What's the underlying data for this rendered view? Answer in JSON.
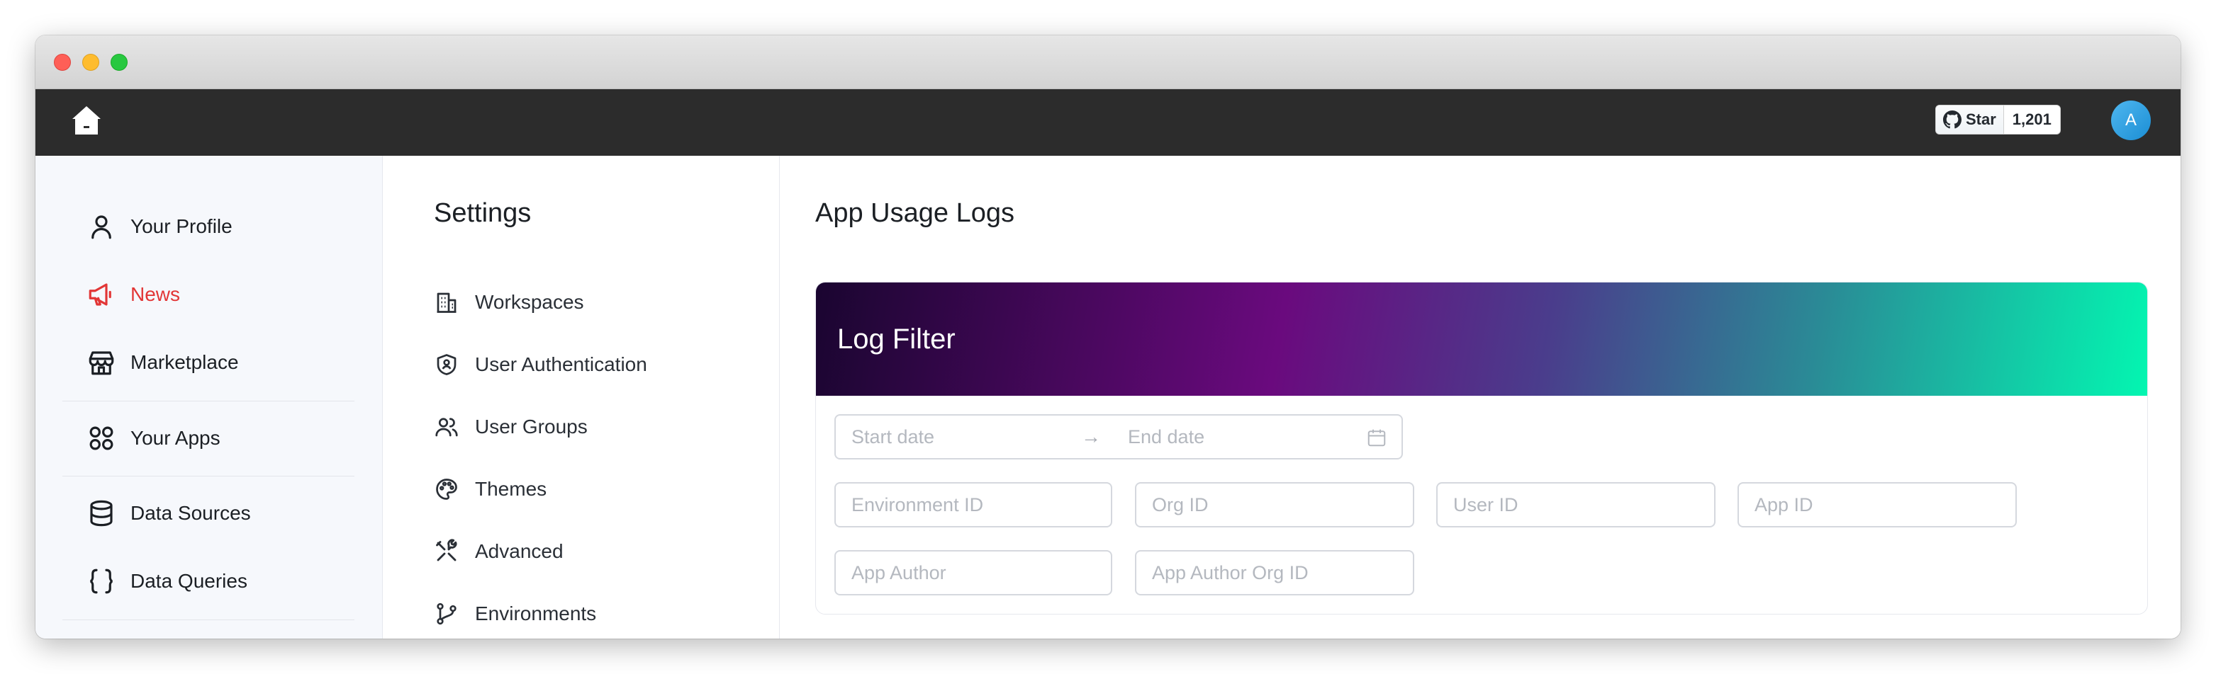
{
  "topbar": {
    "github": {
      "star_label": "Star",
      "count": "1,201"
    },
    "avatar_initial": "A"
  },
  "sidebar": {
    "items": [
      {
        "label": "Your Profile",
        "icon": "user-icon"
      },
      {
        "label": "News",
        "icon": "megaphone-icon",
        "active": true,
        "color": "#e23636"
      },
      {
        "label": "Marketplace",
        "icon": "store-icon"
      },
      {
        "label": "Your Apps",
        "icon": "apps-grid-icon"
      },
      {
        "label": "Data Sources",
        "icon": "database-icon"
      },
      {
        "label": "Data Queries",
        "icon": "braces-icon"
      }
    ]
  },
  "settings": {
    "title": "Settings",
    "items": [
      {
        "label": "Workspaces",
        "icon": "building-icon"
      },
      {
        "label": "User Authentication",
        "icon": "shield-user-icon"
      },
      {
        "label": "User Groups",
        "icon": "users-icon"
      },
      {
        "label": "Themes",
        "icon": "palette-icon"
      },
      {
        "label": "Advanced",
        "icon": "tools-icon"
      },
      {
        "label": "Environments",
        "icon": "git-branch-icon"
      }
    ]
  },
  "main": {
    "title": "App Usage Logs",
    "filter": {
      "title": "Log Filter",
      "start_date_placeholder": "Start date",
      "end_date_placeholder": "End date",
      "environment_id_placeholder": "Environment ID",
      "org_id_placeholder": "Org ID",
      "user_id_placeholder": "User ID",
      "app_id_placeholder": "App ID",
      "app_author_placeholder": "App Author",
      "app_author_org_id_placeholder": "App Author Org ID"
    }
  }
}
